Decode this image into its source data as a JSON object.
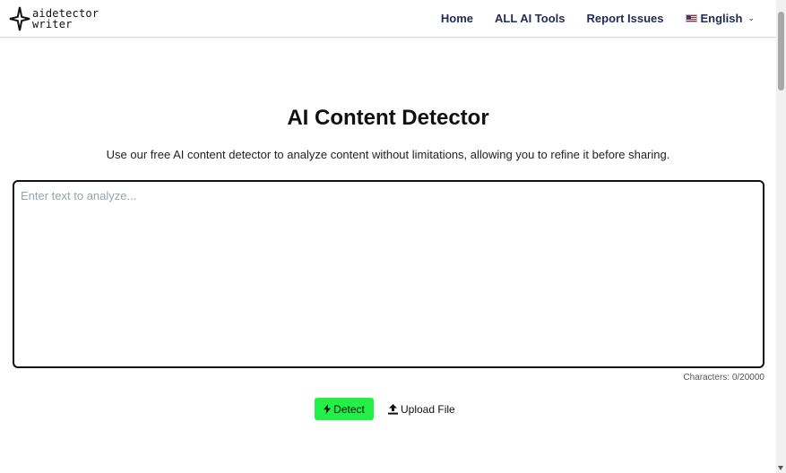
{
  "header": {
    "logo": {
      "line1": "aidetector",
      "line2": "writer"
    },
    "nav": {
      "home": "Home",
      "all_tools": "ALL AI Tools",
      "report": "Report Issues",
      "language": "English"
    }
  },
  "main": {
    "title": "AI Content Detector",
    "subtitle": "Use our free AI content detector to analyze content without limitations, allowing you to refine it before sharing.",
    "input": {
      "placeholder": "Enter text to analyze...",
      "value": ""
    },
    "char_count": "Characters: 0/20000",
    "detect_label": "Detect",
    "upload_label": "Upload File"
  },
  "colors": {
    "detect_button": "#22f046",
    "nav_text": "#1f2a55"
  },
  "icons": [
    "logo-sparkle-icon",
    "us-flag-icon",
    "chevron-down-icon",
    "lightning-icon",
    "upload-icon"
  ]
}
